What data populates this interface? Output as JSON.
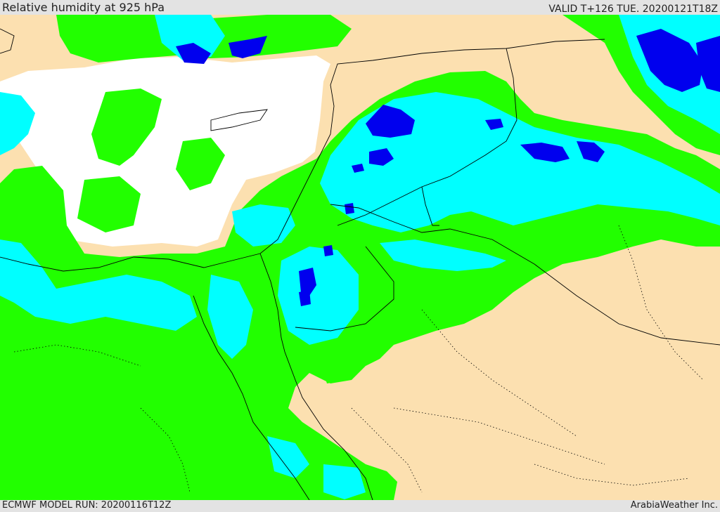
{
  "header": {
    "title": "Relative humidity at 925 hPa",
    "valid_time": "VALID T+126 TUE. 20200121T18Z"
  },
  "footer": {
    "model_run": "ECMWF MODEL RUN: 20200116T12Z",
    "credit": "ArabiaWeather Inc."
  },
  "colors": {
    "land": "#fce0b0",
    "band_green": "#22ff00",
    "band_cyan": "#00ffff",
    "band_blue": "#0000ee",
    "band_white": "#ffffff",
    "borders": "#000000"
  },
  "legend_scale": [
    {
      "color_name": "white"
    },
    {
      "color_name": "green"
    },
    {
      "color_name": "cyan"
    },
    {
      "color_name": "blue"
    }
  ]
}
